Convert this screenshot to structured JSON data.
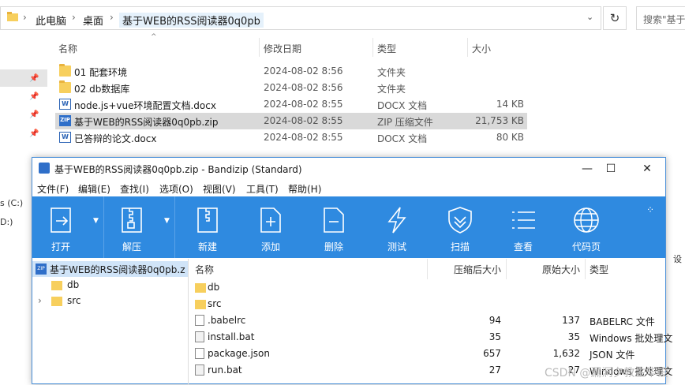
{
  "explorer": {
    "breadcrumb": [
      "此电脑",
      "桌面",
      "基于WEB的RSS阅读器0q0pb"
    ],
    "search_placeholder": "搜索\"基于",
    "columns": {
      "name": "名称",
      "date": "修改日期",
      "type": "类型",
      "size": "大小"
    },
    "files": [
      {
        "name": "01  配套环境",
        "date": "2024-08-02 8:56",
        "type": "文件夹",
        "size": "",
        "icon": "folder-icon"
      },
      {
        "name": "02 db数据库",
        "date": "2024-08-02 8:56",
        "type": "文件夹",
        "size": "",
        "icon": "folder-icon"
      },
      {
        "name": "node.js+vue环境配置文档.docx",
        "date": "2024-08-02 8:55",
        "type": "DOCX 文档",
        "size": "14 KB",
        "icon": "word-icon"
      },
      {
        "name": "基于WEB的RSS阅读器0q0pb.zip",
        "date": "2024-08-02 8:55",
        "type": "ZIP 压缩文件",
        "size": "21,753 KB",
        "icon": "zip-icon",
        "selected": true
      },
      {
        "name": "已答辩的论文.docx",
        "date": "2024-08-02 8:55",
        "type": "DOCX 文档",
        "size": "80 KB",
        "icon": "word-icon"
      }
    ],
    "side_labels": [
      "s (C:)",
      "D:)"
    ],
    "right_label": "设"
  },
  "bandizip": {
    "title": "基于WEB的RSS阅读器0q0pb.zip - Bandizip (Standard)",
    "menu": [
      "文件(F)",
      "编辑(E)",
      "查找(I)",
      "选项(O)",
      "视图(V)",
      "工具(T)",
      "帮助(H)"
    ],
    "toolbar": [
      "打开",
      "解压",
      "新建",
      "添加",
      "删除",
      "测试",
      "扫描",
      "查看",
      "代码页"
    ],
    "tree": {
      "root": "基于WEB的RSS阅读器0q0pb.z",
      "children": [
        "db",
        "src"
      ]
    },
    "list_columns": {
      "name": "名称",
      "packed": "压缩后大小",
      "original": "原始大小",
      "type": "类型"
    },
    "items": [
      {
        "name": "db",
        "packed": "",
        "original": "",
        "type": "",
        "icon": "folder-icon"
      },
      {
        "name": "src",
        "packed": "",
        "original": "",
        "type": "",
        "icon": "folder-icon"
      },
      {
        "name": ".babelrc",
        "packed": "94",
        "original": "137",
        "type": "BABELRC 文件",
        "icon": "file-icon"
      },
      {
        "name": "install.bat",
        "packed": "35",
        "original": "35",
        "type": "Windows 批处理文",
        "icon": "bat-icon"
      },
      {
        "name": "package.json",
        "packed": "657",
        "original": "1,632",
        "type": "JSON 文件",
        "icon": "file-icon"
      },
      {
        "name": "run.bat",
        "packed": "27",
        "original": "27",
        "type": "Windows 批处理文",
        "icon": "bat-icon"
      }
    ]
  },
  "watermark": "CSDN @漏洞夕教生毕设"
}
